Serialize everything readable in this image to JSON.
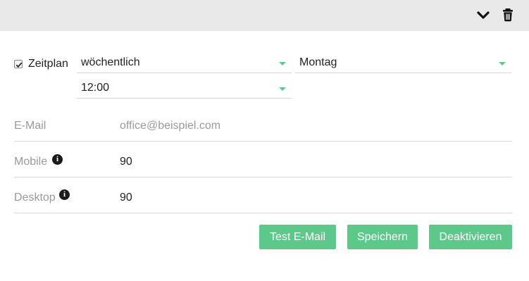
{
  "toolbar": {
    "collapse_icon": "chevron-down-icon",
    "delete_icon": "trash-icon"
  },
  "schedule": {
    "enabled": true,
    "label": "Zeitplan",
    "frequency": "wöchentlich",
    "weekday": "Montag",
    "time": "12:00"
  },
  "fields": {
    "email": {
      "label": "E-Mail",
      "placeholder": "office@beispiel.com",
      "value": ""
    },
    "mobile": {
      "label": "Mobile",
      "value": "90",
      "info_icon": "info-icon"
    },
    "desktop": {
      "label": "Desktop",
      "value": "90",
      "info_icon": "info-icon"
    }
  },
  "actions": {
    "test_email": "Test E-Mail",
    "save": "Speichern",
    "deactivate": "Deaktivieren"
  },
  "colors": {
    "accent": "#5cc98a",
    "header_bg": "#e9e9e9"
  }
}
